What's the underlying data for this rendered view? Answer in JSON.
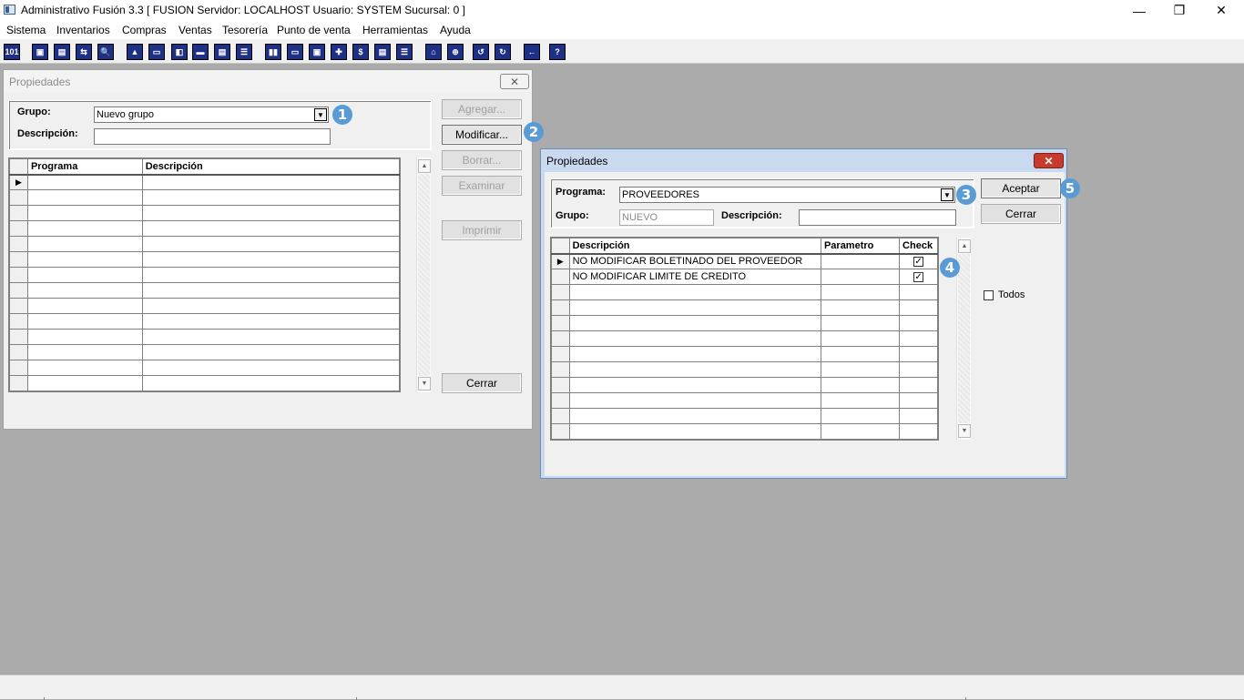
{
  "app": {
    "title": "Administrativo Fusión 3.3 [ FUSION   Servidor: LOCALHOST   Usuario: SYSTEM    Sucursal: 0 ]",
    "minimize": "—",
    "restore": "❐",
    "close": "✕"
  },
  "menu": [
    "Sistema",
    "Inventarios",
    "Compras",
    "Ventas",
    "Tesorería",
    "Punto de venta",
    "Herramientas",
    "Ayuda"
  ],
  "toolbar": [
    "101",
    "▣",
    "▤",
    "⇆",
    "🔍",
    "▲",
    "▭",
    "◧",
    "▬",
    "▤",
    "☰",
    "▮▮",
    "▭",
    "▣",
    "✚",
    "$",
    "▤",
    "☰",
    "⌂",
    "⊕",
    "↺",
    "↻",
    "←",
    "?"
  ],
  "win1": {
    "title": "Propiedades",
    "close": "✕",
    "grupo_label": "Grupo:",
    "grupo_value": "Nuevo grupo",
    "desc_label": "Descripción:",
    "desc_value": "",
    "columns": [
      "Programa",
      "Descripción"
    ],
    "row_marker": "▶",
    "buttons": {
      "agregar": "Agregar...",
      "modificar": "Modificar...",
      "borrar": "Borrar...",
      "examinar": "Examinar",
      "imprimir": "Imprimir",
      "cerrar": "Cerrar"
    }
  },
  "win2": {
    "title": "Propiedades",
    "close": "✕",
    "programa_label": "Programa:",
    "programa_value": "PROVEEDORES",
    "grupo_label": "Grupo:",
    "grupo_value": "NUEVO",
    "desc_label": "Descripción:",
    "desc_value": "",
    "columns": [
      "Descripción",
      "Parametro",
      "Check"
    ],
    "row_marker": "▶",
    "rows": [
      {
        "descripcion": "NO MODIFICAR BOLETINADO DEL PROVEEDOR",
        "parametro": "",
        "check": "✓"
      },
      {
        "descripcion": "NO MODIFICAR LIMITE DE CREDITO",
        "parametro": "",
        "check": "✓"
      }
    ],
    "aceptar": "Aceptar",
    "cerrar": "Cerrar",
    "todos": "Todos"
  },
  "badges": [
    "1",
    "2",
    "3",
    "4",
    "5"
  ],
  "colors": {
    "toolbar_icon": "#1e2f86",
    "badge": "#5b9bd5",
    "mdi_background": "#ababab"
  }
}
